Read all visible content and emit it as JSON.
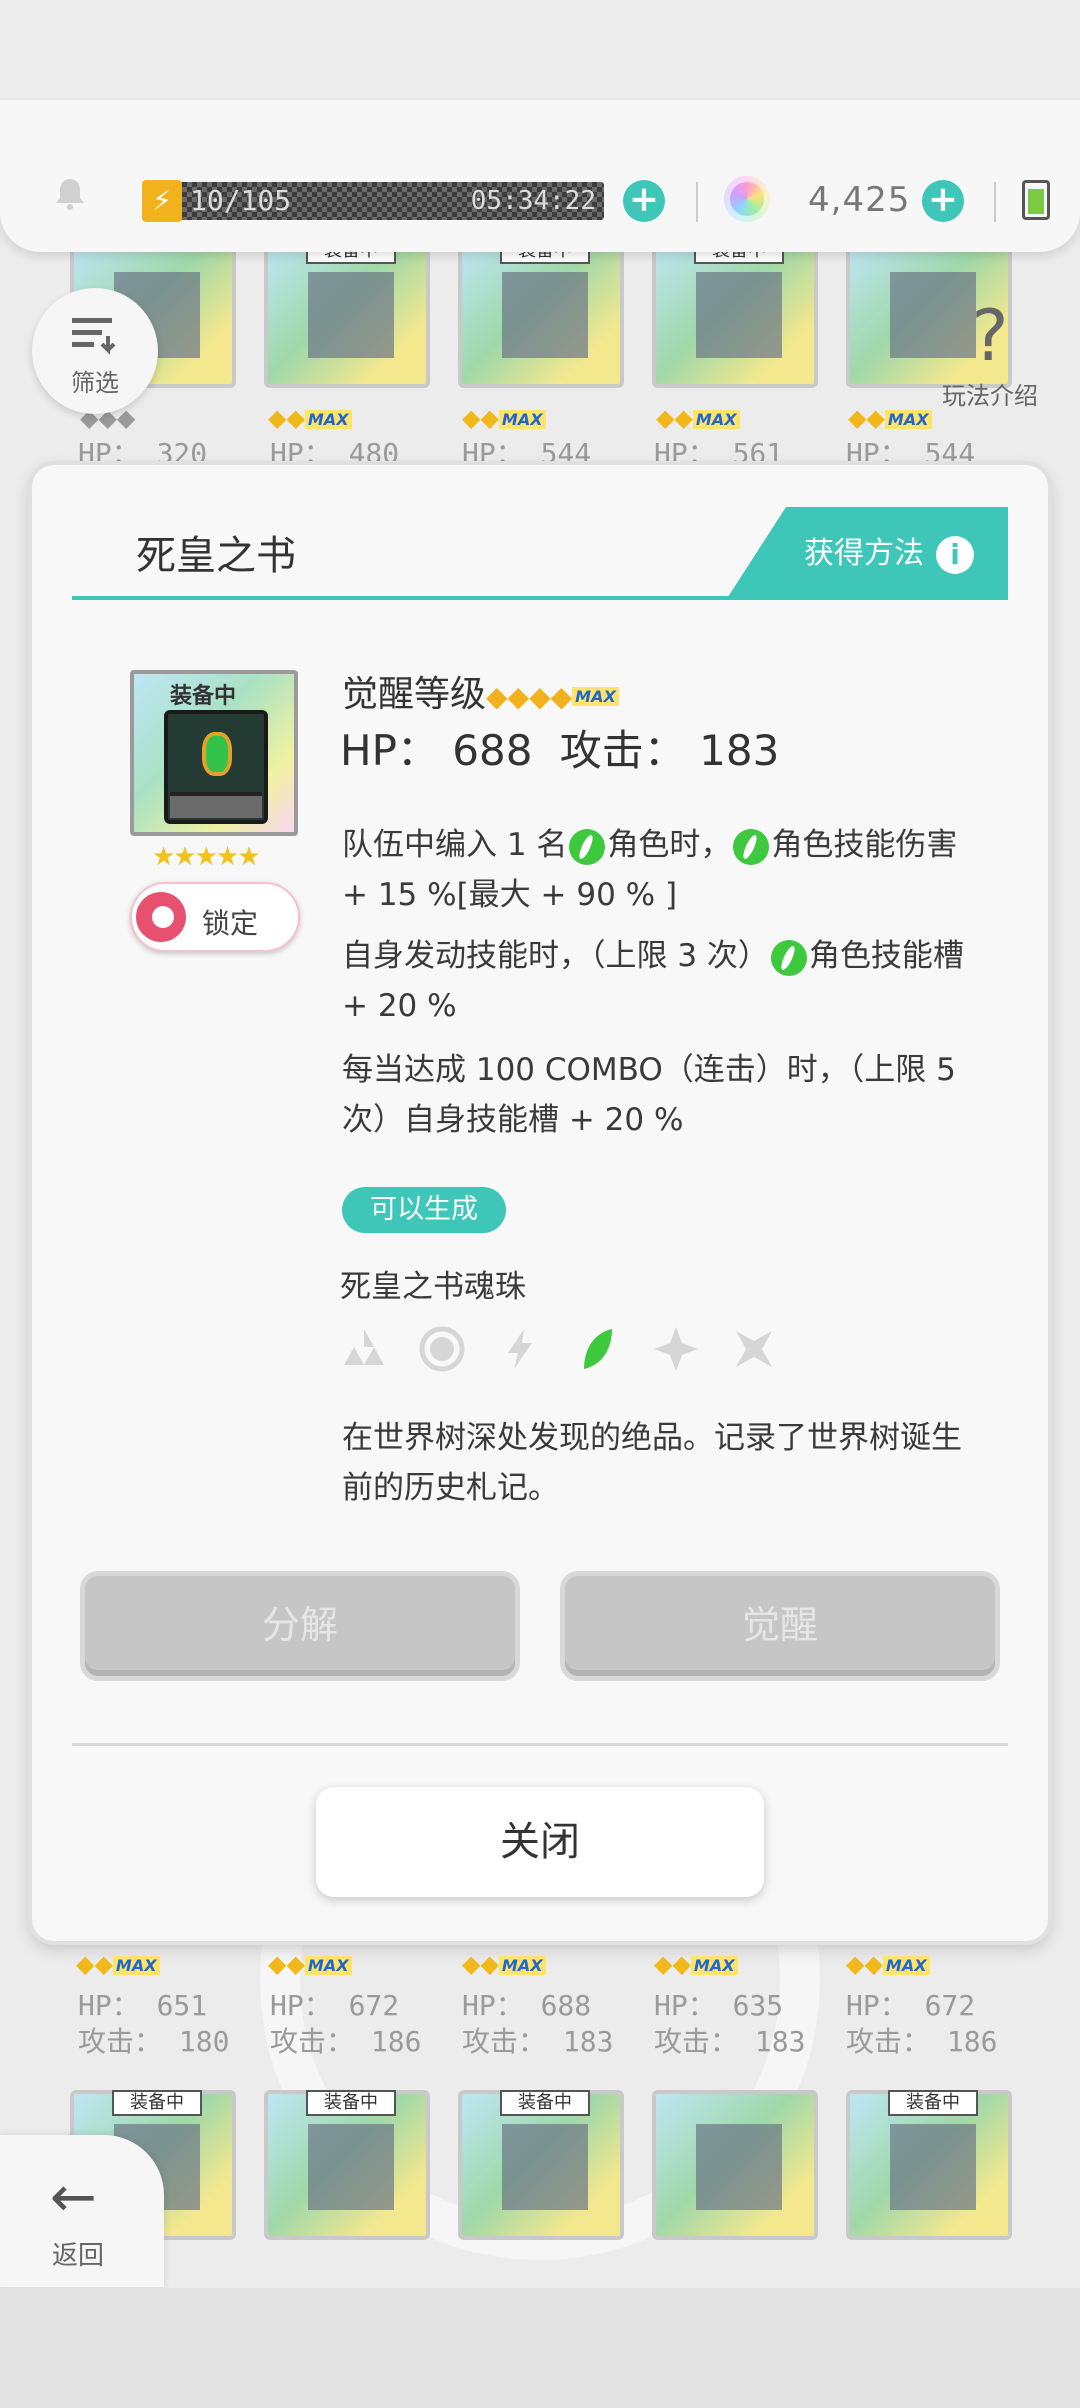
{
  "status_bar": {
    "stamina": "10/105",
    "timer": "05:34:22",
    "gems": "4,425"
  },
  "background": {
    "top_row": [
      {
        "tag": "",
        "hp": "HP： 320",
        "stars": "◆◆◆"
      },
      {
        "tag": "装备中",
        "hp": "HP： 480",
        "stars": "◆◆"
      },
      {
        "tag": "装备中",
        "hp": "HP： 544",
        "stars": "◆◆"
      },
      {
        "tag": "装备中",
        "hp": "HP： 561",
        "stars": "◆◆"
      },
      {
        "tag": "",
        "hp": "HP： 544",
        "stars": "◆◆"
      }
    ],
    "mid_row": [
      {
        "hp": "HP： 651",
        "atk": "攻击： 180"
      },
      {
        "hp": "HP： 672",
        "atk": "攻击： 186"
      },
      {
        "hp": "HP： 688",
        "atk": "攻击： 183"
      },
      {
        "hp": "HP： 635",
        "atk": "攻击： 183"
      },
      {
        "hp": "HP： 672",
        "atk": "攻击： 186"
      }
    ],
    "bottom_row_tags": [
      "装备中",
      "装备中",
      "装备中",
      "",
      "装备中"
    ],
    "max_label": "MAX",
    "filter_label": "筛选",
    "help_label": "玩法介绍",
    "back_label": "返回"
  },
  "modal": {
    "title": "死皇之书",
    "obtain_label": "获得方法",
    "item_tag": "装备中",
    "lock_label": "锁定",
    "awaken_label": "觉醒等级",
    "stats": {
      "hp": "HP： 688",
      "atk": "攻击： 183"
    },
    "desc1_a": "队伍中编入 1 名",
    "desc1_b": "角色时，",
    "desc1_c": "角色技能伤害 + 15 %[最大 + 90 % ]",
    "desc2_a": "自身发动技能时，（上限 3 次）",
    "desc2_b": "角色技能槽 + 20 %",
    "desc3": "每当达成 100 COMBO（连击）时，（上限 5 次）自身技能槽 + 20 %",
    "gen_badge": "可以生成",
    "orb_label": "死皇之书魂珠",
    "lore": "在世界树深处发现的绝品。记录了世界树诞生前的历史札记。",
    "decompose_label": "分解",
    "awaken_btn_label": "觉醒",
    "close_label": "关闭"
  },
  "colors": {
    "accent": "#3ec6b8",
    "leaf": "#3ec83e",
    "gold": "#f2b21d"
  }
}
